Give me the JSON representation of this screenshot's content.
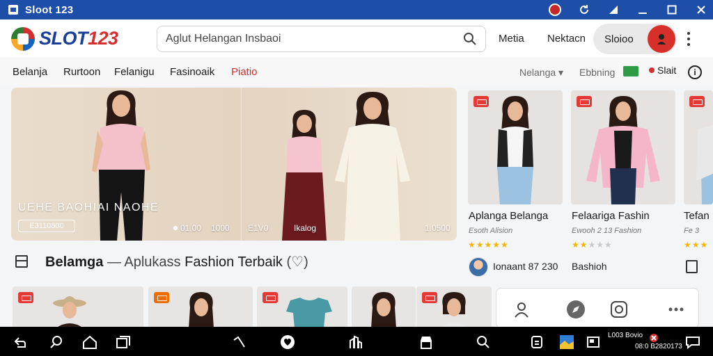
{
  "window": {
    "title": "Sloot 123"
  },
  "header": {
    "logo_text_a": "SLOT",
    "logo_text_b": "123",
    "search_placeholder": "Aglut Helangan Insbaoi",
    "links": [
      "Metia",
      "Nektacn"
    ],
    "signin_label": "Sloioo"
  },
  "categories": {
    "items": [
      {
        "label": "Belanja",
        "active": false
      },
      {
        "label": "Rurtoon",
        "active": false
      },
      {
        "label": "Felanigu",
        "active": false
      },
      {
        "label": "Fasinoaik",
        "active": false
      },
      {
        "label": "Piatio",
        "active": true
      }
    ],
    "filters": [
      "Nelanga ▾",
      "Ebbning"
    ],
    "notif_label": "Slait",
    "info_label": "i"
  },
  "hero": {
    "caption": "UEHE BAOHIAI NAOHE",
    "pill": "E3110600",
    "marks": [
      "01.00",
      "1000",
      "E1V0",
      "Ikalog",
      "1.0500"
    ]
  },
  "products": [
    {
      "name": "Aplanga Belanga",
      "sub": "Esoth Alision",
      "rating": 5,
      "seller": "Ionaant 87 230"
    },
    {
      "name": "Felaariga Fashin",
      "sub": "Ewooh 2 13 Fashion",
      "rating": 3,
      "seller": "Bashioh"
    },
    {
      "name": "Tefan",
      "sub": "Fe 3",
      "rating": 3,
      "seller": ""
    }
  ],
  "section": {
    "title_bold": "Belamga",
    "dash": "—",
    "title_a": "Aplukass",
    "title_b": "Fashion Terbaik",
    "title_c": "(♡)"
  },
  "taskbar": {
    "tray_top": "L003 Bovio",
    "tray_bottom": "08:0 B2820173"
  },
  "colors": {
    "brand_blue": "#1a3f9b",
    "brand_red": "#d32f2f",
    "titlebar": "#1d4fa8",
    "accent_red": "#d72f2a"
  }
}
